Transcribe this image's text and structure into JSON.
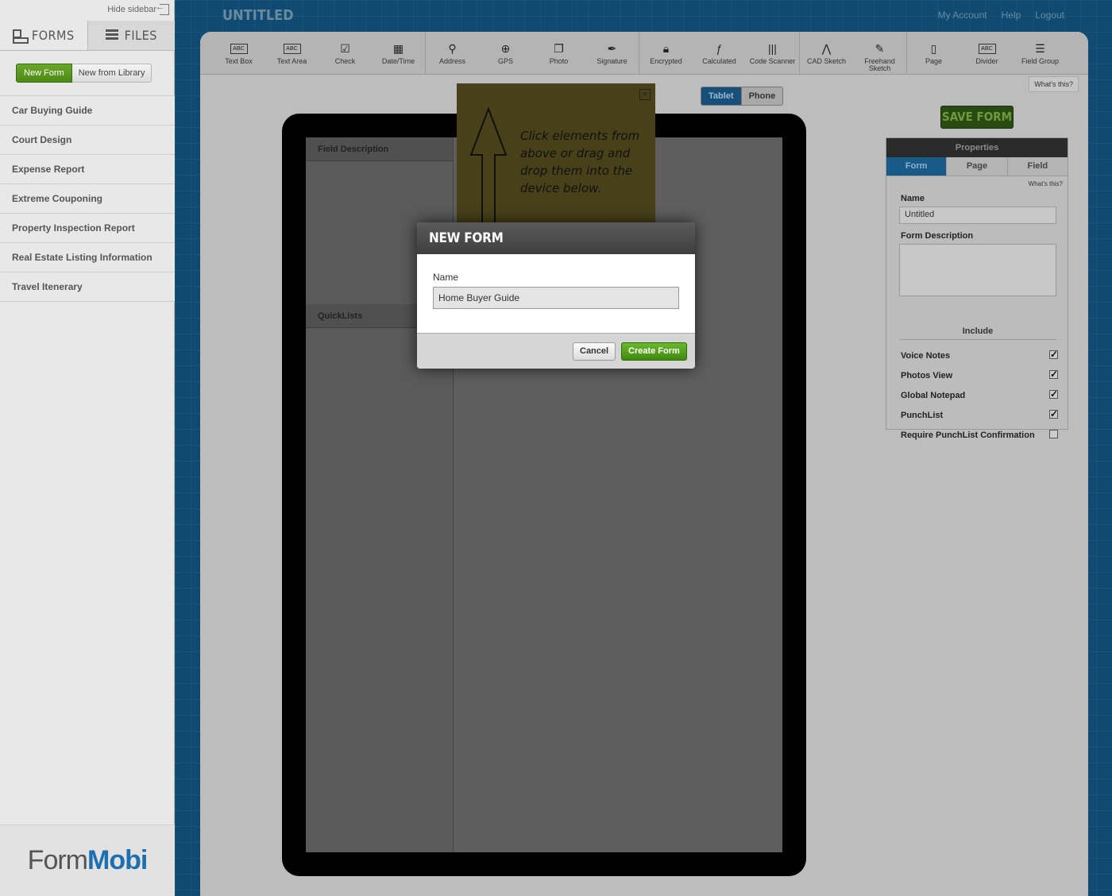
{
  "sidebar": {
    "hide_label": "Hide sidebar",
    "tabs": [
      {
        "label": "FORMS",
        "icon": "forms-icon"
      },
      {
        "label": "FILES",
        "icon": "files-icon"
      }
    ],
    "new_form_label": "New Form",
    "new_from_library_label": "New from Library",
    "forms": [
      "Car Buying Guide",
      "Court Design",
      "Expense Report",
      "Extreme Couponing",
      "Property Inspection Report",
      "Real Estate Listing Information",
      "Travel Itenerary"
    ],
    "logo": {
      "part1": "Form",
      "part2": "Mobi"
    }
  },
  "header": {
    "title": "UNTITLED",
    "links": [
      "My Account",
      "Help",
      "Logout"
    ]
  },
  "toolbar": {
    "tools": [
      {
        "label": "Text Box",
        "icon": "text-box-icon"
      },
      {
        "label": "Text Area",
        "icon": "text-area-icon"
      },
      {
        "label": "Check",
        "icon": "check-icon"
      },
      {
        "label": "Date/Time",
        "icon": "calendar-icon"
      },
      {
        "label": "Address",
        "icon": "map-pin-icon"
      },
      {
        "label": "GPS",
        "icon": "gps-icon"
      },
      {
        "label": "Photo",
        "icon": "photo-icon"
      },
      {
        "label": "Signature",
        "icon": "signature-icon"
      },
      {
        "label": "Encrypted",
        "icon": "lock-icon"
      },
      {
        "label": "Calculated",
        "icon": "function-icon"
      },
      {
        "label": "Code Scanner",
        "icon": "barcode-icon"
      },
      {
        "label": "CAD Sketch",
        "icon": "cad-icon"
      },
      {
        "label": "Freehand Sketch",
        "icon": "pencil-icon"
      },
      {
        "label": "Page",
        "icon": "page-icon"
      },
      {
        "label": "Divider",
        "icon": "divider-icon"
      },
      {
        "label": "Field Group",
        "icon": "field-group-icon"
      }
    ],
    "whats_this": "What's this?"
  },
  "device": {
    "toggle": [
      "Tablet",
      "Phone"
    ],
    "selected": "Tablet",
    "field_description": "Field Description",
    "quicklists": "QuickLists"
  },
  "note": {
    "text": "Click elements from above or drag and drop them into the device below."
  },
  "properties": {
    "save_label": "SAVE FORM",
    "title": "Properties",
    "tabs": [
      "Form",
      "Page",
      "Field"
    ],
    "whats_this": "What's this?",
    "name_label": "Name",
    "name_value": "Untitled",
    "description_label": "Form Description",
    "include_label": "Include",
    "include": [
      {
        "label": "Voice Notes",
        "checked": true
      },
      {
        "label": "Photos View",
        "checked": true
      },
      {
        "label": "Global Notepad",
        "checked": true
      },
      {
        "label": "PunchList",
        "checked": true
      },
      {
        "label": "Require PunchList Confirmation",
        "checked": false
      }
    ]
  },
  "modal": {
    "title": "NEW FORM",
    "name_label": "Name",
    "name_value": "Home Buyer Guide",
    "cancel_label": "Cancel",
    "create_label": "Create Form"
  }
}
